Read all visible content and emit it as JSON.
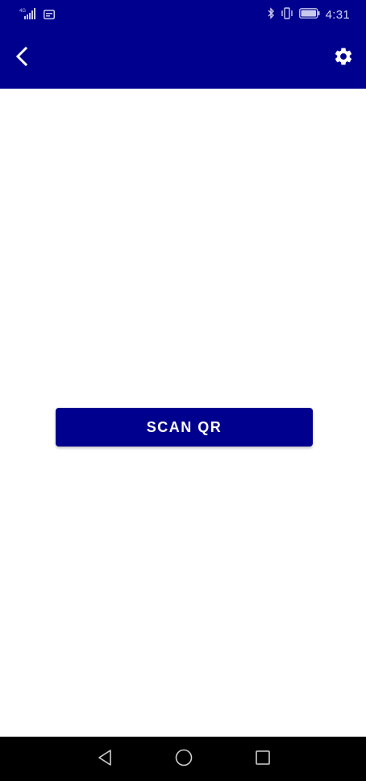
{
  "status_bar": {
    "network_type": "4G",
    "time": "4:31",
    "icons": [
      "signal-icon",
      "sim-card-icon",
      "bluetooth-icon",
      "vibrate-icon",
      "battery-icon"
    ]
  },
  "app_bar": {
    "back_icon": "chevron-left-icon",
    "settings_icon": "gear-icon"
  },
  "main": {
    "scan_button_label": "SCAN QR"
  },
  "navigation_bar": {
    "icons": [
      "back-triangle-icon",
      "home-circle-icon",
      "recents-square-icon"
    ]
  },
  "colors": {
    "primary": "#00008e",
    "background": "#ffffff",
    "nav_background": "#000000"
  }
}
